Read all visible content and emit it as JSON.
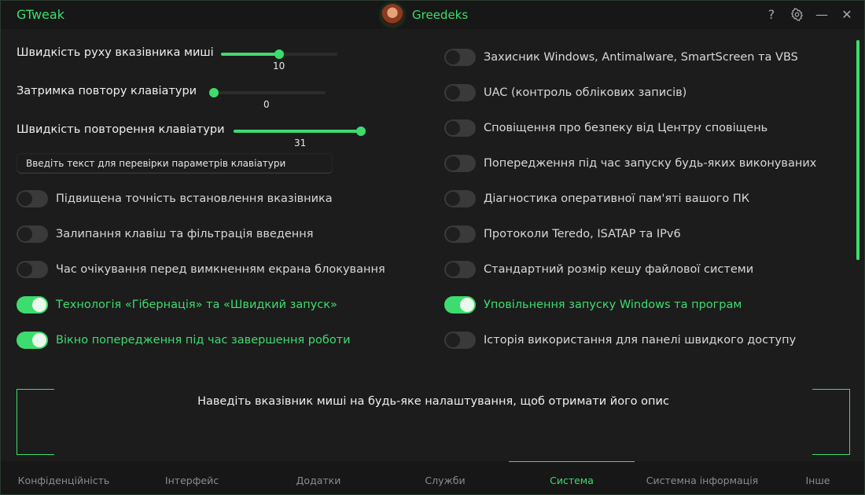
{
  "app": {
    "title": "GTweak",
    "user": "Greedeks"
  },
  "window_controls": {
    "help": "?",
    "minimize": "—",
    "close": "✕"
  },
  "sliders": [
    {
      "label": "Швидкість руху вказівника миші",
      "value": "10",
      "level": 0.5
    },
    {
      "label": "Затримка повтору клавіатури",
      "value": "0",
      "level": 0.0
    },
    {
      "label": "Швидкість повторення клавіатури",
      "value": "31",
      "level": 1.0
    }
  ],
  "keyboard_test": {
    "placeholder": "Введіть текст для перевірки параметрів клавіатури"
  },
  "toggles_left": [
    {
      "label": "Підвищена точність встановлення вказівника",
      "on": false
    },
    {
      "label": "Залипання клавіш та фільтрація введення",
      "on": false
    },
    {
      "label": "Час очікування перед вимкненням екрана блокування",
      "on": false
    },
    {
      "label": "Технологія «Гібернація» та «Швидкий запуск»",
      "on": true
    },
    {
      "label": "Вікно попередження під час завершення роботи",
      "on": true
    }
  ],
  "toggles_right": [
    {
      "label": "Захисник Windows, Antimalware, SmartScreen та VBS",
      "on": false
    },
    {
      "label": "UAC (контроль облікових записів)",
      "on": false
    },
    {
      "label": "Сповіщення про безпеку від Центру сповіщень",
      "on": false
    },
    {
      "label": "Попередження під час запуску будь-яких виконуваних",
      "on": false
    },
    {
      "label": "Діагностика оперативної пам'яті вашого ПК",
      "on": false
    },
    {
      "label": "Протоколи Teredo, ISATAP та IPv6",
      "on": false
    },
    {
      "label": "Стандартний розмір кешу файлової системи",
      "on": false
    },
    {
      "label": "Уповільнення запуску Windows та програм",
      "on": true
    },
    {
      "label": "Історія використання для панелі швидкого доступу",
      "on": false
    }
  ],
  "description": {
    "text": "Наведіть вказівник миші на будь-яке налаштування, щоб отримати його опис"
  },
  "tabs": [
    {
      "label": "Конфіденційність",
      "active": false
    },
    {
      "label": "Інтерфейс",
      "active": false
    },
    {
      "label": "Додатки",
      "active": false
    },
    {
      "label": "Служби",
      "active": false
    },
    {
      "label": "Система",
      "active": true
    },
    {
      "label": "Системна інформація",
      "active": false
    },
    {
      "label": "Інше",
      "active": false
    }
  ],
  "colors": {
    "accent": "#3ddc6e",
    "background": "#1c1c1c"
  }
}
